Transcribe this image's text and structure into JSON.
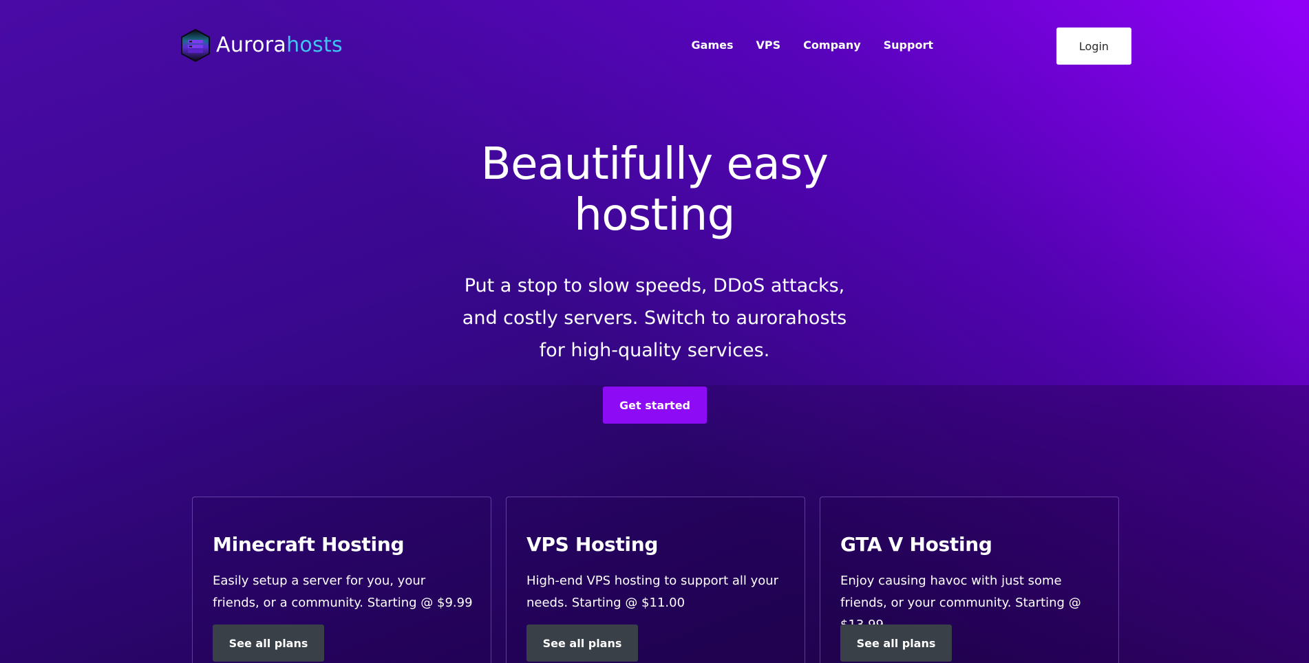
{
  "brand": {
    "name_part1": "Aurora",
    "name_part2": "hosts",
    "accent_color": "#3ec6f2",
    "logo_icon": "hexagon-server-icon"
  },
  "nav": {
    "links": [
      "Games",
      "VPS",
      "Company",
      "Support"
    ],
    "login_label": "Login"
  },
  "hero": {
    "title": "Beautifully easy hosting",
    "subtitle": "Put a stop to slow speeds, DDoS attacks, and costly servers. Switch to aurorahosts for high-quality services.",
    "cta_label": "Get started",
    "cta_color": "#8e0bf5"
  },
  "cards": [
    {
      "title": "Minecraft Hosting",
      "description": "Easily setup a server for you, your friends, or a community. Starting @ $9.99",
      "button_label": "See all plans"
    },
    {
      "title": "VPS Hosting",
      "description": "High-end VPS hosting to support all your needs. Starting @ $11.00",
      "button_label": "See all plans"
    },
    {
      "title": "GTA V Hosting",
      "description": "Enjoy causing havoc with just some friends, or your community. Starting @ $13.99",
      "button_label": "See all plans"
    }
  ]
}
